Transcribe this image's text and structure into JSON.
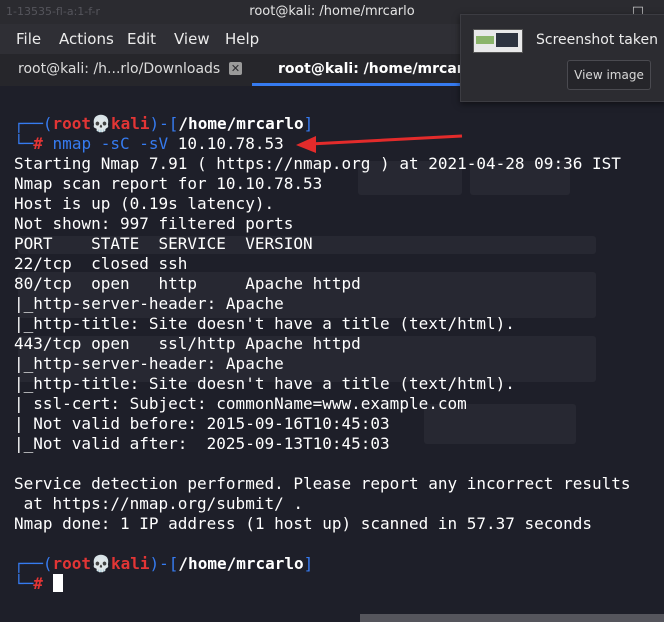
{
  "window": {
    "title": "root@kali: /home/mrcarlo",
    "ghost_title": "1-13535-fl-a:1-f-r"
  },
  "menu": [
    "File",
    "Actions",
    "Edit",
    "View",
    "Help"
  ],
  "tabs": [
    {
      "label": "root@kali: /h...rlo/Downloads",
      "active": false
    },
    {
      "label": "root@kali: /home/mrcarlo",
      "active": true
    }
  ],
  "notification": {
    "title": "Screenshot taken",
    "button": "View image"
  },
  "prompt": {
    "user": "root",
    "skull": "💀",
    "host": "kali",
    "path": "/home/mrcarlo",
    "symbol": "#"
  },
  "command": {
    "name": "nmap",
    "flags": "-sC -sV",
    "target": "10.10.78.53"
  },
  "output": [
    "Starting Nmap 7.91 ( https://nmap.org ) at 2021-04-28 09:36 IST",
    "Nmap scan report for 10.10.78.53",
    "Host is up (0.19s latency).",
    "Not shown: 997 filtered ports",
    "PORT    STATE  SERVICE  VERSION",
    "22/tcp  closed ssh",
    "80/tcp  open   http     Apache httpd",
    "|_http-server-header: Apache",
    "|_http-title: Site doesn't have a title (text/html).",
    "443/tcp open   ssl/http Apache httpd",
    "|_http-server-header: Apache",
    "|_http-title: Site doesn't have a title (text/html).",
    "| ssl-cert: Subject: commonName=www.example.com",
    "| Not valid before: 2015-09-16T10:45:03",
    "|_Not valid after:  2025-09-13T10:45:03",
    "",
    "Service detection performed. Please report any incorrect results",
    " at https://nmap.org/submit/ .",
    "Nmap done: 1 IP address (1 host up) scanned in 57.37 seconds"
  ],
  "colors": {
    "prompt_blue": "#367bf0",
    "prompt_red": "#e23535",
    "flag_green": "#6bc26b",
    "arrow_red": "#e32b2b",
    "terminal_bg": "#1e1f29"
  }
}
